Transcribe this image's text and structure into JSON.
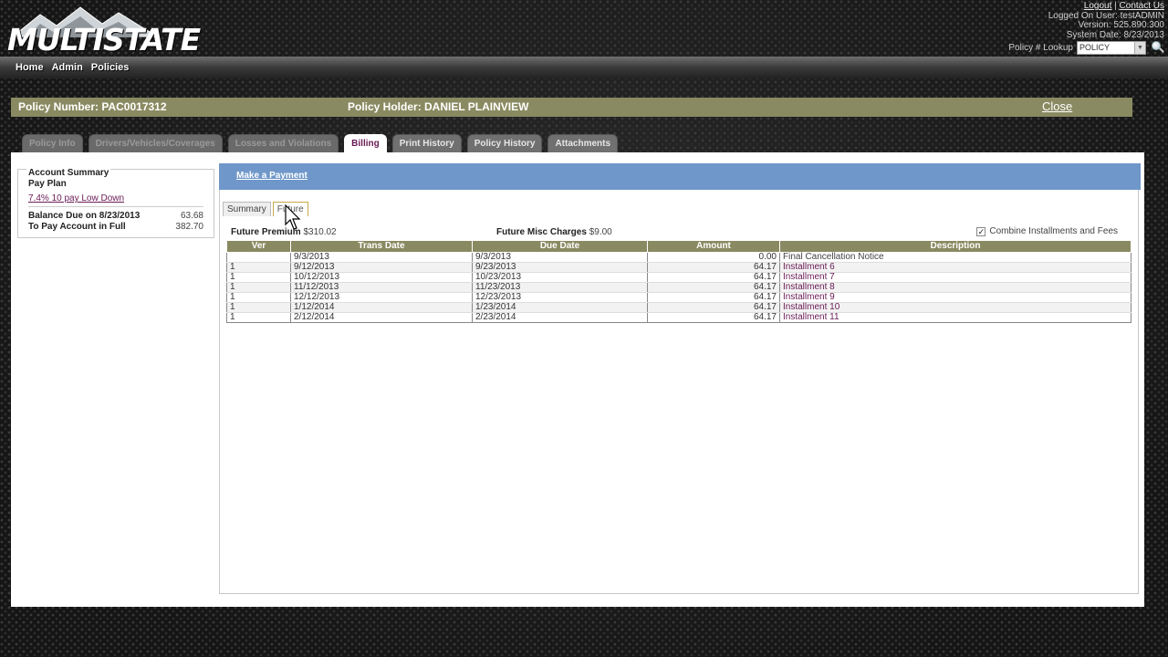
{
  "header": {
    "logo_text": "MULTISTATE",
    "logout": "Logout",
    "contact": "Contact Us",
    "logged_on": "Logged On User:   testADMIN",
    "version": "Version: 525.890.300",
    "system_date": "System Date: 8/23/2013",
    "lookup_label": "Policy # Lookup",
    "lookup_value": "POLICY"
  },
  "nav": [
    "Home",
    "Admin",
    "Policies"
  ],
  "policy": {
    "number_label": "Policy Number: PAC0017312",
    "holder_label": "Policy Holder: DANIEL PLAINVIEW",
    "close": "Close"
  },
  "tabs": [
    {
      "label": "Policy Info",
      "state": "disabled"
    },
    {
      "label": "Drivers/Vehicles/Coverages",
      "state": "disabled"
    },
    {
      "label": "Losses and Violations",
      "state": "disabled"
    },
    {
      "label": "Billing",
      "state": "active"
    },
    {
      "label": "Print History",
      "state": "normal"
    },
    {
      "label": "Policy History",
      "state": "normal"
    },
    {
      "label": "Attachments",
      "state": "normal"
    }
  ],
  "account": {
    "title": "Account Summary",
    "pay_plan_label": "Pay Plan",
    "pay_plan_value": "7.4% 10 pay Low Down",
    "balance_label": "Balance Due on 8/23/2013",
    "balance_value": "63.68",
    "full_label": "To Pay Account in Full",
    "full_value": "382.70"
  },
  "billing": {
    "make_payment": "Make a Payment",
    "subtabs": [
      "Summary",
      "Future"
    ],
    "future_premium_label": "Future Premium",
    "future_premium_value": "$310.02",
    "future_misc_label": "Future Misc Charges",
    "future_misc_value": "$9.00",
    "combine_label": "Combine Installments and Fees",
    "columns": [
      "Ver",
      "Trans Date",
      "Due Date",
      "Amount",
      "Description"
    ],
    "rows": [
      {
        "ver": "",
        "trans": "9/3/2013",
        "due": "9/3/2013",
        "amount": "0.00",
        "desc": "Final Cancellation Notice"
      },
      {
        "ver": "1",
        "trans": "9/12/2013",
        "due": "9/23/2013",
        "amount": "64.17",
        "desc": "Installment 6"
      },
      {
        "ver": "1",
        "trans": "10/12/2013",
        "due": "10/23/2013",
        "amount": "64.17",
        "desc": "Installment 7"
      },
      {
        "ver": "1",
        "trans": "11/12/2013",
        "due": "11/23/2013",
        "amount": "64.17",
        "desc": "Installment 8"
      },
      {
        "ver": "1",
        "trans": "12/12/2013",
        "due": "12/23/2013",
        "amount": "64.17",
        "desc": "Installment 9"
      },
      {
        "ver": "1",
        "trans": "1/12/2014",
        "due": "1/23/2014",
        "amount": "64.17",
        "desc": "Installment 10"
      },
      {
        "ver": "1",
        "trans": "2/12/2014",
        "due": "2/23/2014",
        "amount": "64.17",
        "desc": "Installment 11"
      }
    ]
  },
  "colors": {
    "accent_olive": "#8a8a62",
    "pay_blue": "#6f97c9",
    "link_purple": "#6a1a55"
  }
}
